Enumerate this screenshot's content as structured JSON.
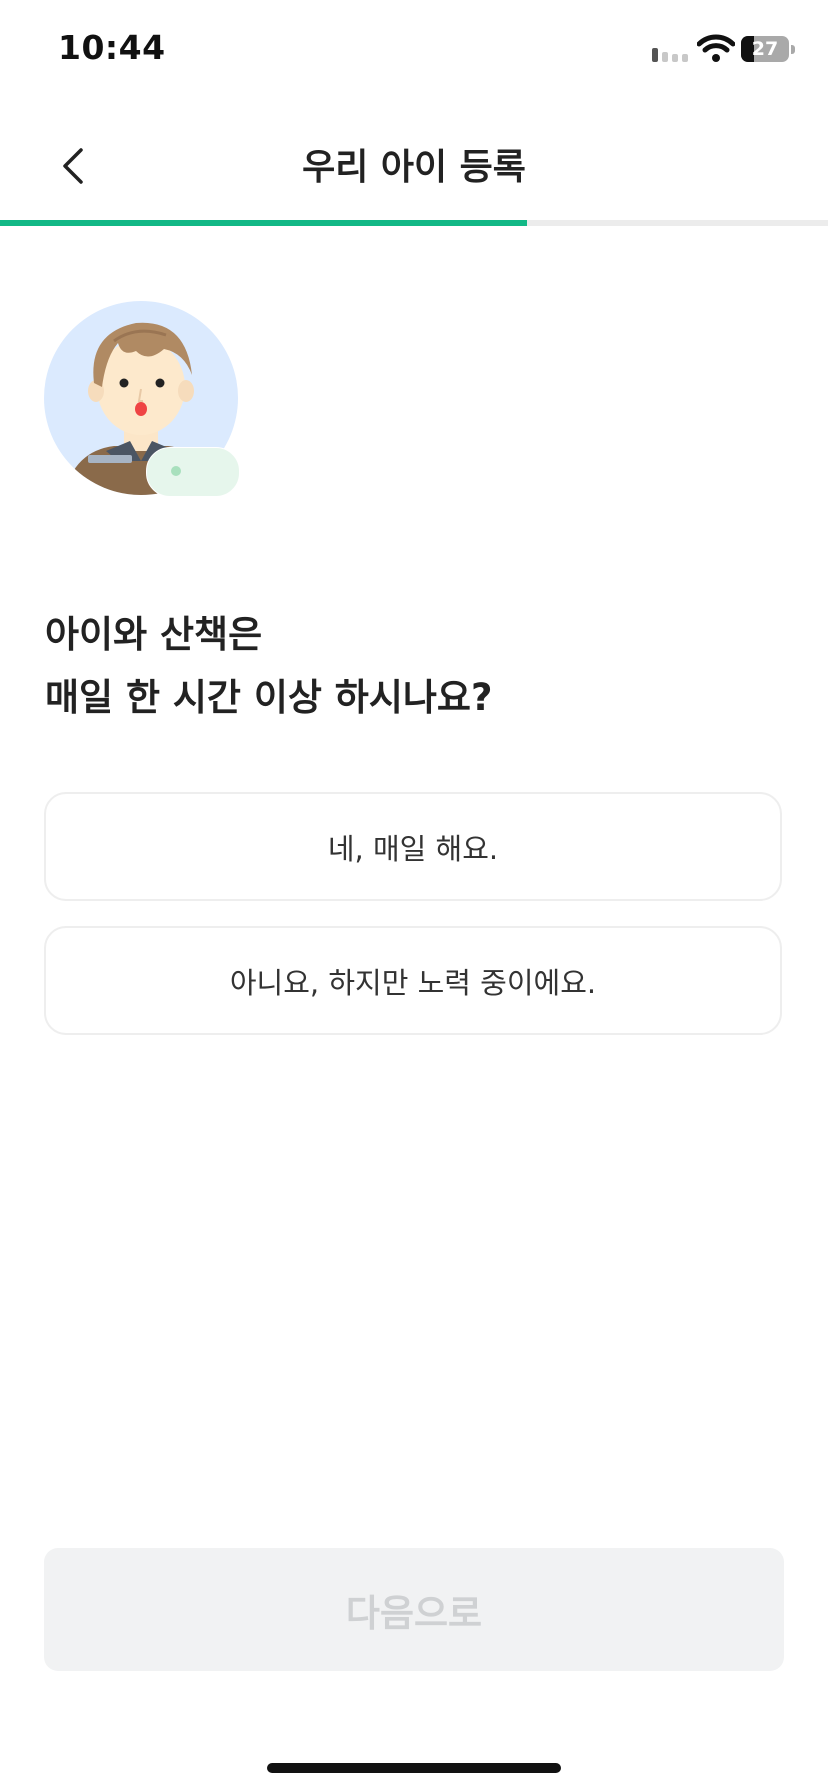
{
  "status_bar": {
    "time": "10:44",
    "battery_level": "27"
  },
  "header": {
    "title": "우리 아이 등록",
    "progress_percent": 63.6
  },
  "question": {
    "line1": "아이와 산책은",
    "line2": "매일 한 시간 이상 하시나요?"
  },
  "options": [
    {
      "label": "네, 매일 해요."
    },
    {
      "label": "아니요, 하지만 노력 중이에요."
    }
  ],
  "next_button": {
    "label": "다음으로",
    "enabled": false
  },
  "colors": {
    "accent": "#12b886",
    "avatar_background": "#dbeafe",
    "button_disabled_bg": "#f1f2f3",
    "button_disabled_text": "#cfd1d3"
  }
}
